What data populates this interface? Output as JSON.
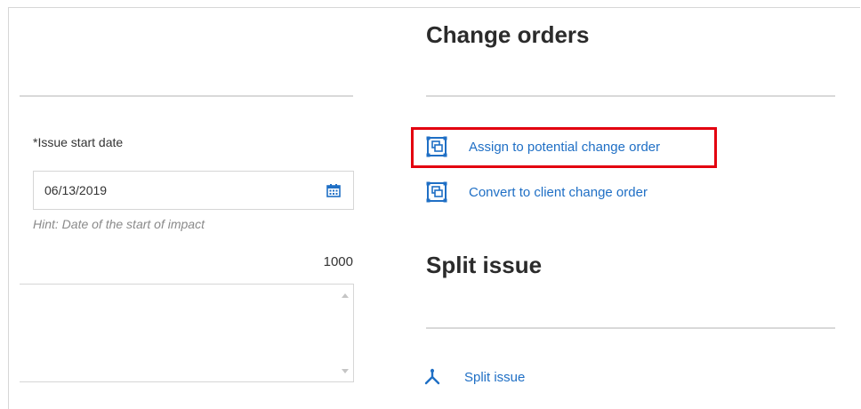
{
  "form": {
    "issue_start_date_label": "*Issue start date",
    "issue_start_date_value": "06/13/2019",
    "issue_start_date_hint": "Hint: Date of the start of impact",
    "char_counter": "1000"
  },
  "change_orders": {
    "title": "Change orders",
    "actions": [
      {
        "label": "Assign to potential change order",
        "icon": "change-order-icon",
        "highlighted": true
      },
      {
        "label": "Convert to client change order",
        "icon": "change-order-icon",
        "highlighted": false
      }
    ]
  },
  "split_issue": {
    "title": "Split issue",
    "action_label": "Split issue",
    "icon": "split-icon"
  },
  "colors": {
    "link": "#1f6fc5",
    "highlight": "#e3000f",
    "divider": "#d9d9d9"
  }
}
